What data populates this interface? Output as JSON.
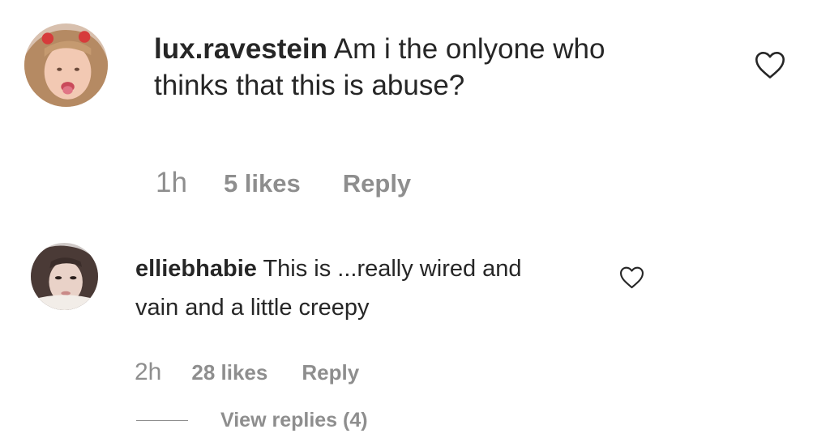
{
  "comments": [
    {
      "username": "lux.ravestein",
      "text": "Am i the onlyone who thinks that this is abuse?",
      "time": "1h",
      "likes": "5 likes",
      "reply_label": "Reply",
      "avatar_icon": "profile-photo"
    },
    {
      "username": "elliebhabie",
      "text": "This is ...really wired and vain and a little creepy",
      "time": "2h",
      "likes": "28 likes",
      "reply_label": "Reply",
      "view_replies_label": "View replies (4)",
      "avatar_icon": "profile-photo"
    }
  ],
  "icons": {
    "like": "heart-outline-icon"
  },
  "colors": {
    "text": "#262626",
    "secondary": "#8e8e8e"
  }
}
